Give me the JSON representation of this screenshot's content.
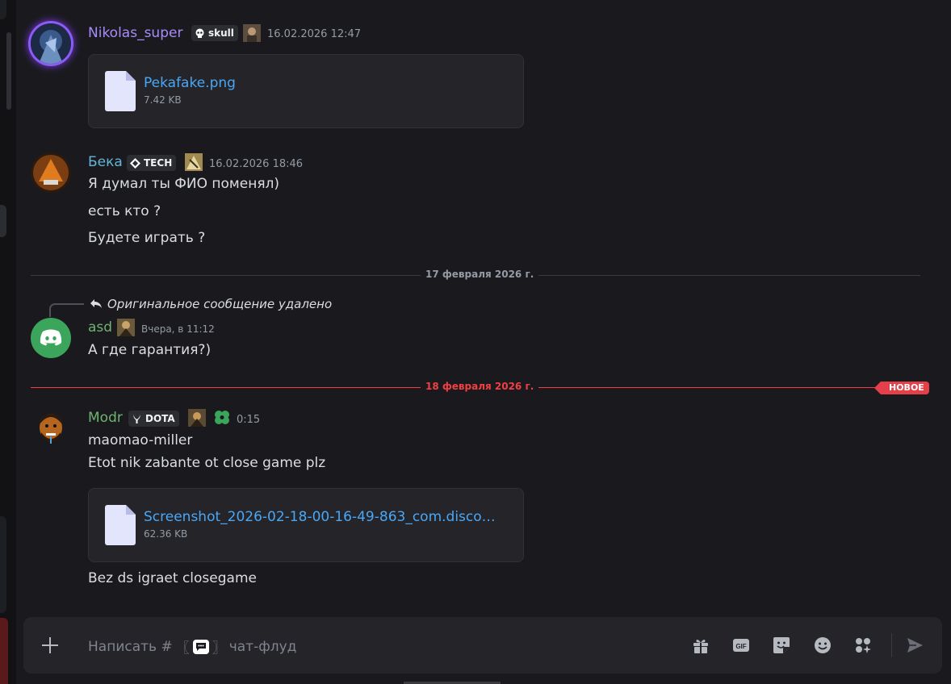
{
  "messages": [
    {
      "author": "Nikolas_super",
      "author_color": "#a78bfa",
      "tag": "skull",
      "timestamp": "16.02.2026 12:47",
      "attachment": {
        "name": "Pekafake.png",
        "size": "7.42 KB"
      }
    },
    {
      "author": "Бека",
      "author_color": "#64b5d9",
      "tag": "TECH",
      "timestamp": "16.02.2026 18:46",
      "lines": [
        "Я думал ты ФИО поменял)",
        "есть кто ?",
        "Будете играть ?"
      ]
    },
    {
      "reply_text": "Оригинальное сообщение удалено",
      "author": "asd",
      "author_color": "#6fb36f",
      "timestamp": "Вчера, в 11:12",
      "lines": [
        "А где гарантия?)"
      ]
    },
    {
      "author": "Modr",
      "author_color": "#6fb36f",
      "tag": "DOTA",
      "timestamp": "0:15",
      "lines": [
        "maomao-miller",
        "Etot nik zabante ot close game plz"
      ],
      "attachment": {
        "name": "Screenshot_2026-02-18-00-16-49-863_com.disco…",
        "size": "62.36 KB"
      },
      "after_line": "Bez ds igraet closegame"
    }
  ],
  "dividers": [
    {
      "label": "17 февраля 2026 г.",
      "color": "#949ba4"
    },
    {
      "label": "18 февраля 2026 г.",
      "color": "#f23f43",
      "badge": "НОВОЕ"
    }
  ],
  "composer": {
    "placeholder_prefix": "Написать #",
    "channel_left_bracket": "〖",
    "channel_right_bracket": "〗",
    "channel_name": "чат-флуд",
    "icons": [
      "gift-icon",
      "gif-icon",
      "sticker-icon",
      "emoji-icon",
      "apps-icon",
      "send-icon"
    ]
  }
}
